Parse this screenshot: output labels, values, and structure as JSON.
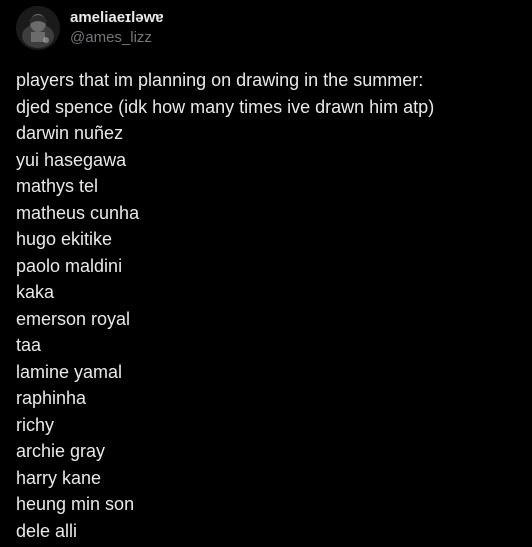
{
  "author": {
    "display_name": "ameliaeɪləwɐ",
    "handle": "@ames_lizz",
    "avatar_icon": "profile-photo"
  },
  "post": {
    "lines": [
      "players that im planning on drawing in the summer:",
      "djed spence (idk how many times ive drawn him atp)",
      "darwin nuñez",
      "yui hasegawa",
      "mathys tel",
      "matheus cunha",
      "hugo ekitike",
      "paolo maldini",
      "kaka",
      "emerson royal",
      "taa",
      "lamine yamal",
      "raphinha",
      "richy",
      "archie gray",
      "harry kane",
      "heung min son",
      "dele alli"
    ]
  },
  "colors": {
    "background": "#000000",
    "text": "#e7e9ea",
    "secondary_text": "#71767b"
  }
}
